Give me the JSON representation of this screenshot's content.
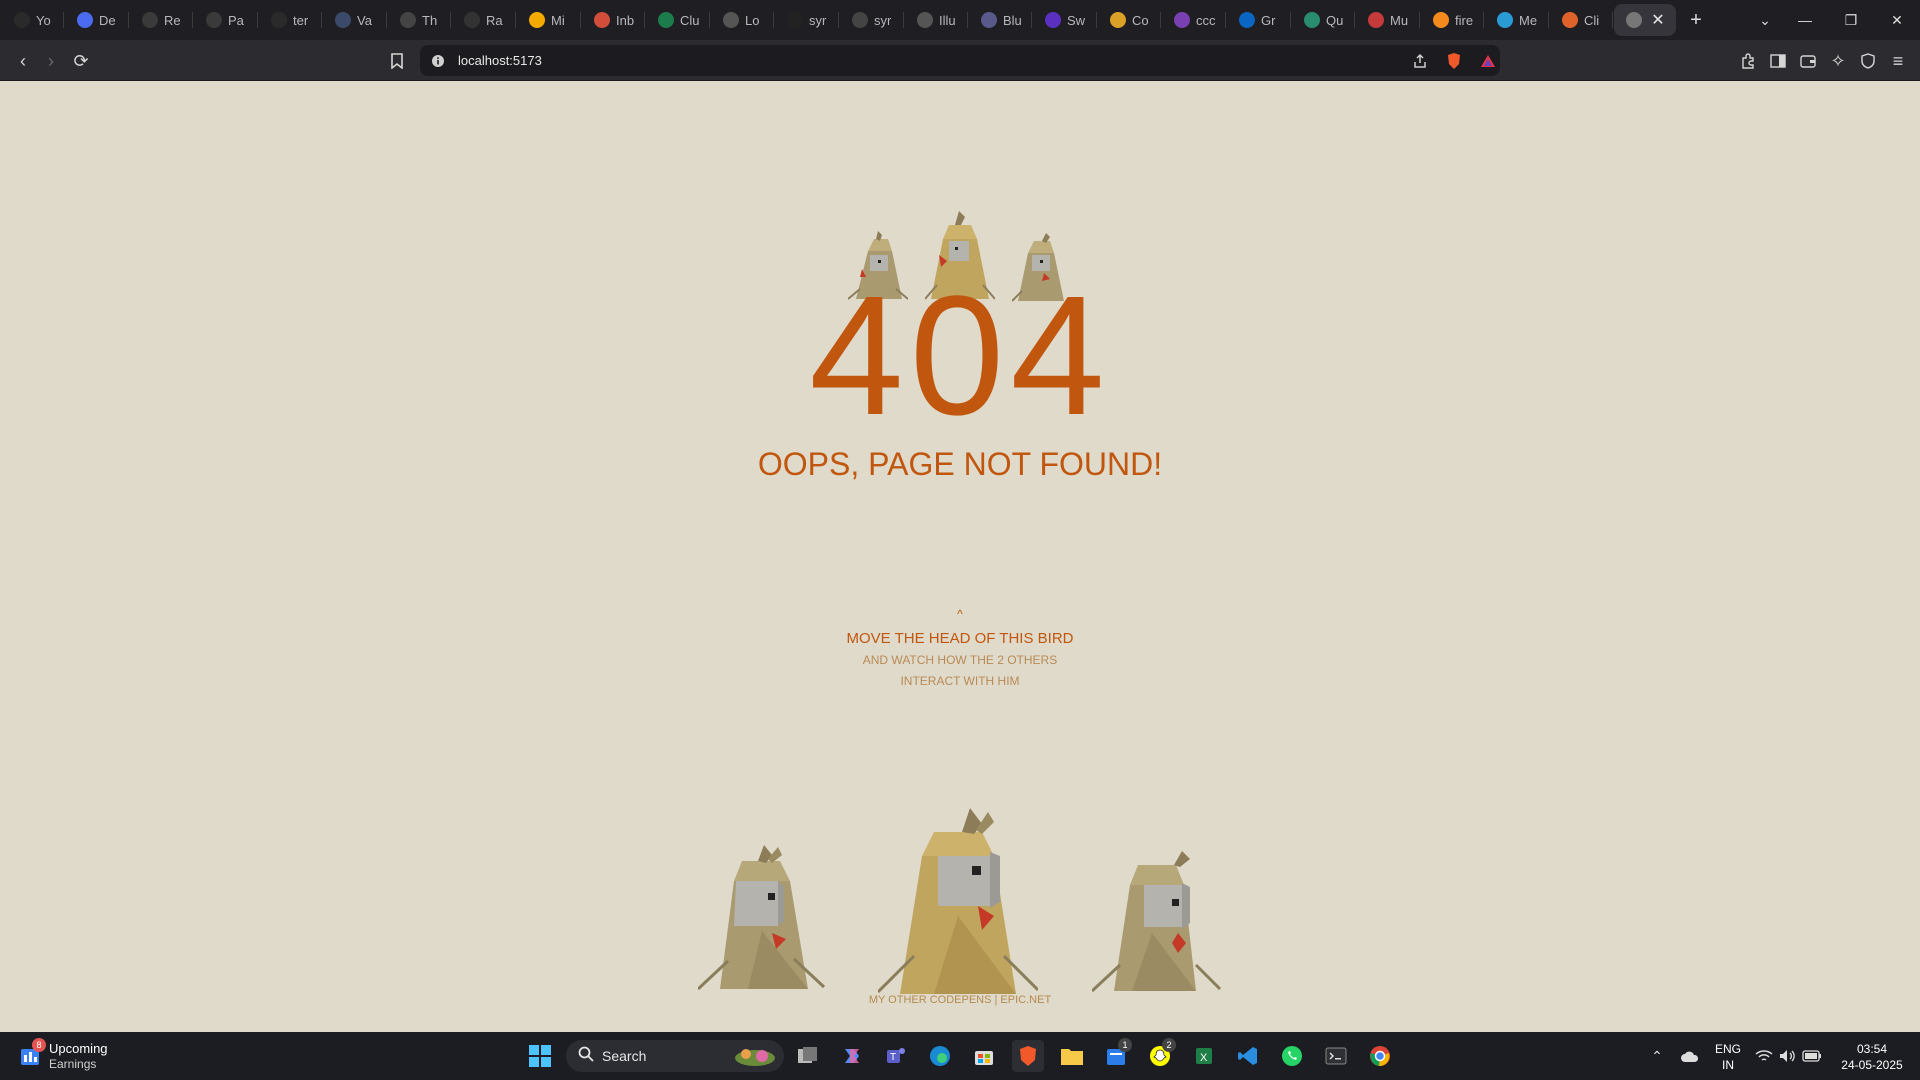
{
  "browser": {
    "tabs": [
      {
        "label": "Yo",
        "icon": "github-icon",
        "color": "#2a2a2a"
      },
      {
        "label": "De",
        "icon": "dev-bird-icon",
        "color": "#4b6cf0"
      },
      {
        "label": "Re",
        "icon": "react-icon",
        "color": "#3a3a3a"
      },
      {
        "label": "Pa",
        "icon": "openai-icon",
        "color": "#3a3a3a"
      },
      {
        "label": "ter",
        "icon": "github-icon",
        "color": "#2a2a2a"
      },
      {
        "label": "Va",
        "icon": "tb-icon",
        "color": "#3b4a6b"
      },
      {
        "label": "Th",
        "icon": "vercel-icon",
        "color": "#444"
      },
      {
        "label": "Ra",
        "icon": "rr-icon",
        "color": "#333"
      },
      {
        "label": "Mi",
        "icon": "microsoft-icon",
        "color": "#f2a900"
      },
      {
        "label": "Inb",
        "icon": "gmail-icon",
        "color": "#d24d3a"
      },
      {
        "label": "Clu",
        "icon": "mongodb-icon",
        "color": "#1d7c4b"
      },
      {
        "label": "Lo",
        "icon": "loop-icon",
        "color": "#555"
      },
      {
        "label": "syr",
        "icon": "triangle-icon",
        "color": "#222"
      },
      {
        "label": "syr",
        "icon": "link-icon",
        "color": "#444"
      },
      {
        "label": "Illu",
        "icon": "illustration-icon",
        "color": "#555"
      },
      {
        "label": "Blu",
        "icon": "blue-icon",
        "color": "#5a5a8a"
      },
      {
        "label": "Sw",
        "icon": "ui-icon",
        "color": "#5b2fc0"
      },
      {
        "label": "Co",
        "icon": "smile-icon",
        "color": "#d9a125"
      },
      {
        "label": "ccc",
        "icon": "fx-icon",
        "color": "#7a3fb0"
      },
      {
        "label": "Gr",
        "icon": "linkedin-icon",
        "color": "#0a66c2"
      },
      {
        "label": "Qu",
        "icon": "chatgpt-icon",
        "color": "#2a8c6e"
      },
      {
        "label": "Mu",
        "icon": "mu-icon",
        "color": "#c53a3a"
      },
      {
        "label": "fire",
        "icon": "firebase-icon",
        "color": "#f48a1e"
      },
      {
        "label": "Me",
        "icon": "arrow-icon",
        "color": "#2b9bd6"
      },
      {
        "label": "Cli",
        "icon": "nodes-icon",
        "color": "#e0622b"
      },
      {
        "label": "",
        "icon": "bird-favicon-icon",
        "color": "#777"
      }
    ],
    "url": "localhost:5173"
  },
  "page": {
    "code": "404",
    "message": "OOPS, PAGE NOT FOUND!",
    "caret": "^",
    "instruction": "MOVE THE HEAD OF THIS BIRD",
    "hint_line1": "AND WATCH HOW THE 2 OTHERS",
    "hint_line2": "INTERACT WITH HIM",
    "footer": "MY OTHER CODEPENS | EPIC.NET",
    "accent_color": "#c1570e",
    "background_color": "#e0dacb"
  },
  "taskbar": {
    "weather_title": "Upcoming",
    "weather_sub": "Earnings",
    "weather_badge": "8",
    "search_label": "Search",
    "lang": "ENG",
    "region": "IN",
    "time": "03:54",
    "date": "24-05-2025",
    "badge_store": "1",
    "badge_snap": "2"
  }
}
